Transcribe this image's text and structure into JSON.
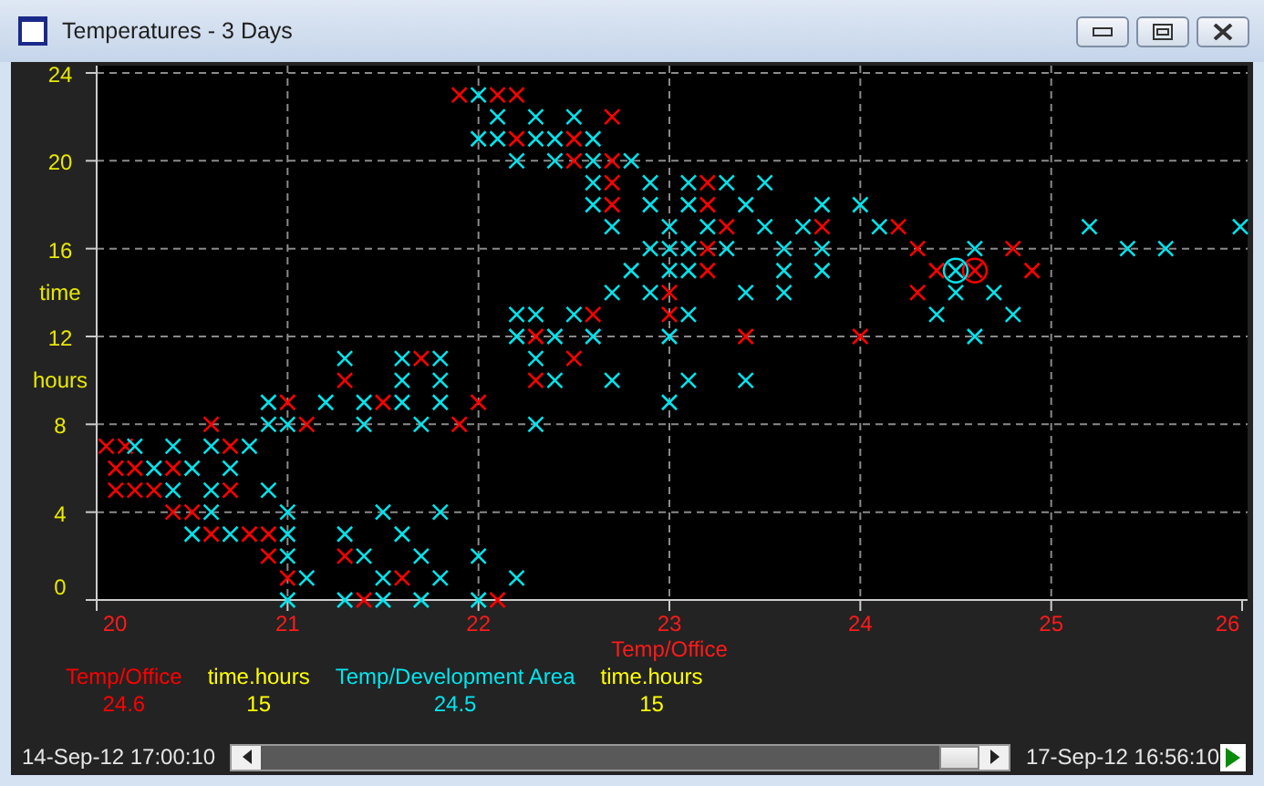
{
  "window": {
    "title": "Temperatures - 3 Days"
  },
  "chart": {
    "chart_data": {
      "type": "scatter",
      "grid": true,
      "xlabel": "Temp/Office",
      "ylabel": "time hours",
      "xlim": [
        20,
        26
      ],
      "ylim": [
        0,
        24
      ],
      "xticks": [
        20,
        21,
        22,
        23,
        24,
        25,
        26
      ],
      "yticks": [
        0,
        4,
        8,
        12,
        16,
        20,
        24
      ],
      "series": [
        {
          "name": "Temp/Office",
          "color": "#ff0000",
          "x": [
            21.4,
            22.1,
            21.0,
            21.6,
            20.9,
            21.3,
            20.6,
            20.8,
            20.9,
            20.4,
            20.5,
            20.1,
            20.2,
            20.3,
            20.7,
            20.1,
            20.2,
            20.4,
            20.05,
            20.15,
            20.7,
            20.6,
            21.1,
            21.9,
            21.0,
            21.5,
            22.0,
            21.3,
            22.3,
            21.7,
            22.5,
            22.3,
            23.4,
            24.0,
            22.6,
            23.0,
            23.0,
            24.3,
            23.2,
            24.4,
            24.6,
            24.9,
            23.2,
            24.3,
            24.8,
            23.3,
            23.8,
            24.2,
            22.7,
            23.2,
            22.7,
            23.2,
            22.5,
            22.7,
            22.2,
            22.5,
            22.7,
            21.9,
            22.1,
            22.2
          ],
          "values": [
            0,
            0,
            1,
            1,
            2,
            2,
            3,
            3,
            3,
            4,
            4,
            5,
            5,
            5,
            5,
            6,
            6,
            6,
            7,
            7,
            7,
            8,
            8,
            8,
            9,
            9,
            9,
            10,
            10,
            11,
            11,
            12,
            12,
            12,
            13,
            13,
            14,
            14,
            15,
            15,
            15,
            15,
            16,
            16,
            16,
            17,
            17,
            17,
            18,
            18,
            19,
            19,
            20,
            20,
            21,
            21,
            22,
            23,
            23,
            23
          ]
        },
        {
          "name": "Temp/Development Area",
          "color": "#00e5ee",
          "x": [
            21.0,
            21.3,
            21.5,
            21.7,
            22.0,
            21.1,
            21.5,
            21.8,
            22.2,
            21.0,
            21.4,
            21.7,
            22.0,
            20.5,
            20.7,
            21.0,
            21.3,
            21.6,
            20.6,
            21.0,
            21.5,
            21.8,
            20.4,
            20.6,
            20.9,
            20.3,
            20.5,
            20.7,
            20.2,
            20.4,
            20.6,
            20.8,
            20.9,
            21.0,
            21.4,
            21.7,
            22.3,
            20.9,
            21.2,
            21.4,
            21.6,
            21.8,
            23.0,
            21.6,
            21.8,
            22.4,
            22.7,
            23.1,
            23.4,
            21.3,
            21.6,
            21.8,
            22.3,
            22.2,
            22.4,
            22.6,
            23.0,
            24.6,
            22.2,
            22.3,
            22.5,
            23.1,
            24.4,
            24.8,
            22.7,
            22.9,
            23.4,
            23.6,
            24.5,
            24.7,
            22.8,
            23.0,
            23.1,
            23.6,
            23.8,
            24.5,
            22.9,
            23.0,
            23.1,
            23.3,
            23.6,
            23.8,
            24.6,
            25.4,
            25.6,
            22.7,
            23.0,
            23.2,
            23.5,
            23.7,
            24.1,
            25.2,
            26.0,
            22.6,
            22.9,
            23.1,
            23.4,
            23.8,
            24.0,
            22.6,
            22.9,
            23.1,
            23.3,
            23.5,
            22.2,
            22.4,
            22.6,
            22.8,
            22.0,
            22.1,
            22.3,
            22.4,
            22.6,
            22.1,
            22.3,
            22.5,
            22.0
          ],
          "values": [
            0,
            0,
            0,
            0,
            0,
            1,
            1,
            1,
            1,
            2,
            2,
            2,
            2,
            3,
            3,
            3,
            3,
            3,
            4,
            4,
            4,
            4,
            5,
            5,
            5,
            6,
            6,
            6,
            7,
            7,
            7,
            7,
            8,
            8,
            8,
            8,
            8,
            9,
            9,
            9,
            9,
            9,
            9,
            10,
            10,
            10,
            10,
            10,
            10,
            11,
            11,
            11,
            11,
            12,
            12,
            12,
            12,
            12,
            13,
            13,
            13,
            13,
            13,
            13,
            14,
            14,
            14,
            14,
            14,
            14,
            15,
            15,
            15,
            15,
            15,
            15,
            16,
            16,
            16,
            16,
            16,
            16,
            16,
            16,
            16,
            17,
            17,
            17,
            17,
            17,
            17,
            17,
            17,
            18,
            18,
            18,
            18,
            18,
            18,
            19,
            19,
            19,
            19,
            19,
            20,
            20,
            20,
            20,
            21,
            21,
            21,
            21,
            21,
            22,
            22,
            22,
            23
          ]
        }
      ]
    }
  },
  "legend": [
    {
      "kind": "series",
      "value": "24.6"
    },
    {
      "kind": "axis",
      "label": "time.hours",
      "value": "15",
      "color": "#ffff00"
    },
    {
      "kind": "series",
      "value": "24.5"
    },
    {
      "kind": "axis",
      "label": "time.hours",
      "value": "15",
      "color": "#ffff00"
    }
  ],
  "time_range": {
    "start": "14-Sep-12 17:00:10",
    "end": "17-Sep-12 16:56:10"
  }
}
